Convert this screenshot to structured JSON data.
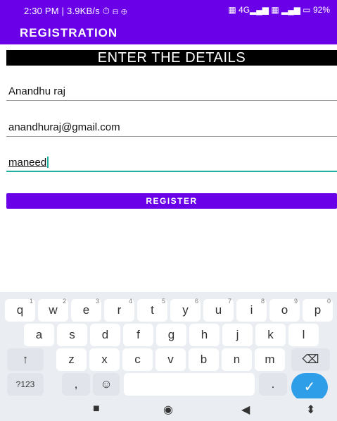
{
  "status": {
    "time": "2:30 PM | 3.9KB/s ⏱ ⊟ ⊕",
    "right": "▦ 4G▂▄▆ ▦ ▂▄▆ ▭ 92%"
  },
  "appbar": {
    "title": "REGISTRATION"
  },
  "heading": "ENTER THE DETAILS",
  "fields": [
    {
      "value": "Anandhu raj"
    },
    {
      "value": "anandhuraj@gmail.com"
    },
    {
      "value": "maneed"
    }
  ],
  "register_label": "REGISTER",
  "keyboard": {
    "row1": [
      "q",
      "w",
      "e",
      "r",
      "t",
      "y",
      "u",
      "i",
      "o",
      "p"
    ],
    "row1_nums": [
      "1",
      "2",
      "3",
      "4",
      "5",
      "6",
      "7",
      "8",
      "9",
      "0"
    ],
    "row2": [
      "a",
      "s",
      "d",
      "f",
      "g",
      "h",
      "j",
      "k",
      "l"
    ],
    "row3": [
      "z",
      "x",
      "c",
      "v",
      "b",
      "n",
      "m"
    ],
    "shift": "↑",
    "backspace": "⌫",
    "symbols": "?123",
    "comma": ",",
    "emoji": "☺",
    "period": ".",
    "enter": "✓"
  },
  "nav": {
    "recents": "■",
    "home": "◉",
    "back": "◀",
    "rotate": "⬍"
  }
}
